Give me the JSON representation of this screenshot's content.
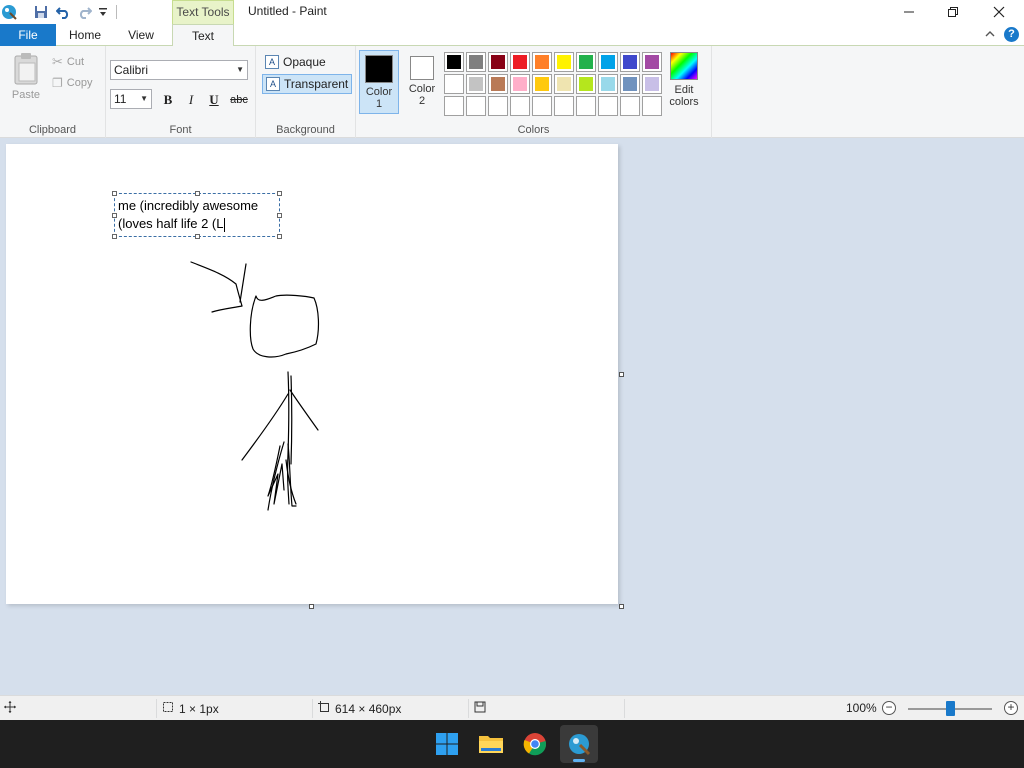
{
  "window": {
    "title": "Untitled - Paint",
    "contextual_tab": "Text Tools"
  },
  "tabs": [
    {
      "label": "File"
    },
    {
      "label": "Home"
    },
    {
      "label": "View"
    },
    {
      "label": "Text",
      "active": true
    }
  ],
  "clipboard": {
    "paste": "Paste",
    "cut": "Cut",
    "copy": "Copy",
    "label": "Clipboard"
  },
  "font": {
    "family": "Calibri",
    "size": "11",
    "bold": "B",
    "italic": "I",
    "underline": "U",
    "strikethrough": "abc",
    "label": "Font"
  },
  "background": {
    "opaque": "Opaque",
    "transparent": "Transparent",
    "selected": "transparent",
    "label": "Background"
  },
  "colors": {
    "color1_label": "Color\n1",
    "color1_value": "#000000",
    "color2_label": "Color\n2",
    "color2_value": "#ffffff",
    "label": "Colors",
    "edit_label": "Edit\ncolors",
    "palette": [
      "#000000",
      "#7f7f7f",
      "#880015",
      "#ed1c24",
      "#ff7f27",
      "#fff200",
      "#22b14c",
      "#00a2e8",
      "#3f48cc",
      "#a349a4",
      "#ffffff",
      "#c3c3c3",
      "#b97a57",
      "#ffaec9",
      "#ffc90e",
      "#efe4b0",
      "#b5e61d",
      "#99d9ea",
      "#7092be",
      "#c8bfe7",
      "#ffffff",
      "#ffffff",
      "#ffffff",
      "#ffffff",
      "#ffffff",
      "#ffffff",
      "#ffffff",
      "#ffffff",
      "#ffffff",
      "#ffffff"
    ]
  },
  "canvas": {
    "text_line1": "me (incredibly awesome",
    "text_line2": "(loves half life 2 (L"
  },
  "status": {
    "selection_size": "1 × 1px",
    "image_size": "614 × 460px",
    "zoom": "100%",
    "zoom_level": 1.0
  },
  "taskbar": {
    "apps": [
      "start",
      "file-explorer",
      "chrome",
      "paint"
    ],
    "active": "paint"
  }
}
